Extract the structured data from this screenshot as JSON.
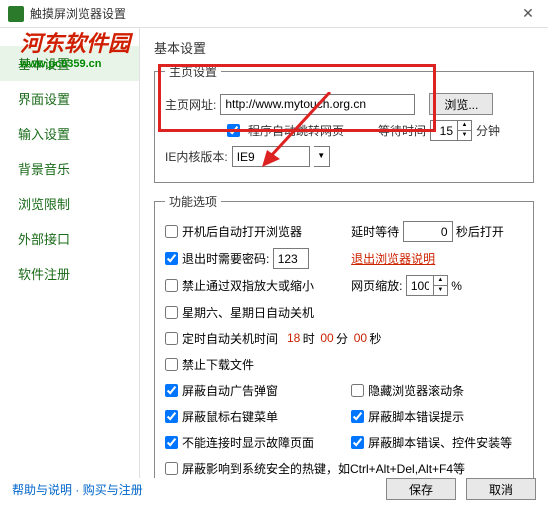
{
  "titlebar": {
    "title": "触摸屏浏览器设置"
  },
  "watermark": {
    "text": "河东软件园",
    "sub": "www.pc0359.cn"
  },
  "sidebar": {
    "items": [
      {
        "label": "基本设置"
      },
      {
        "label": "界面设置"
      },
      {
        "label": "输入设置"
      },
      {
        "label": "背景音乐"
      },
      {
        "label": "浏览限制"
      },
      {
        "label": "外部接口"
      },
      {
        "label": "软件注册"
      }
    ]
  },
  "sections": {
    "main_title": "基本设置",
    "homepage": {
      "legend": "主页设置",
      "addr_label": "主页网址:",
      "addr_value": "http://www.mytouch.org.cn",
      "browse_btn": "浏览...",
      "auto_jump": "程序自动跳转网页",
      "wait_label": "等待时间",
      "wait_value": "15",
      "wait_unit": "分钟",
      "ie_label": "IE内核版本:",
      "ie_value": "IE9"
    },
    "options": {
      "legend": "功能选项",
      "boot_open": "开机后自动打开浏览器",
      "delay_label": "延时等待",
      "delay_value": "0",
      "delay_unit": "秒后打开",
      "exit_pwd": "退出时需要密码:",
      "exit_pwd_value": "123",
      "exit_note": "退出浏览器说明",
      "no_pinch": "禁止通过双指放大或缩小",
      "zoom_label": "网页缩放:",
      "zoom_value": "100",
      "zoom_unit": "%",
      "weekend_off": "星期六、星期日自动关机",
      "timed_off": "定时自动关机时间",
      "time_h": "18",
      "time_h_u": "时",
      "time_m": "00",
      "time_m_u": "分",
      "time_s": "00",
      "time_s_u": "秒",
      "no_download": "禁止下载文件",
      "block_ads": "屏蔽自动广告弹窗",
      "hide_scroll": "隐藏浏览器滚动条",
      "block_rclick": "屏蔽鼠标右键菜单",
      "block_script_err": "屏蔽脚本错误提示",
      "show_fault": "不能连接时显示故障页面",
      "block_script_ctrl": "屏蔽脚本错误、控件安装等",
      "block_hotkeys": "屏蔽影响到系统安全的热键，如Ctrl+Alt+Del,Alt+F4等"
    }
  },
  "footer": {
    "help": "帮助与说明",
    "sep": " · ",
    "buy": "购买与注册",
    "save": "保存",
    "cancel": "取消"
  }
}
